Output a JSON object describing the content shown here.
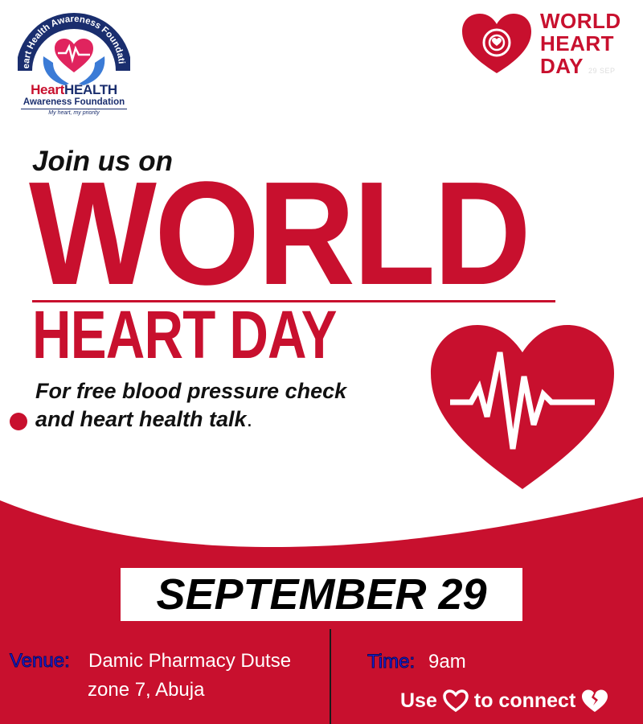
{
  "logo": {
    "arc_text": "Heart Health Awareness Foundation",
    "word_heart": "Heart",
    "word_health": "HEALTH",
    "subtitle": "Awareness Foundation",
    "tagline": "My heart, my priority"
  },
  "whd_logo": {
    "line1": "WORLD",
    "line2": "HEART",
    "line3": "DAY",
    "date": "29 SEP"
  },
  "headline": {
    "intro": "Join us on",
    "world": "WORLD",
    "heart_day": "HEART DAY"
  },
  "description": {
    "line1": "For free blood pressure check",
    "line2": "and heart health talk",
    "period": "."
  },
  "event": {
    "date": "SEPTEMBER 29",
    "venue_label": "Venue:",
    "venue_line1": "Damic Pharmacy Dutse",
    "venue_line2": "zone 7, Abuja",
    "time_label": "Time:",
    "time_value": "9am",
    "connect_prefix": "Use",
    "connect_suffix": "to connect"
  },
  "colors": {
    "brand_red": "#c8102e",
    "navy": "#1a2e6e",
    "label_blue": "#1e1ee6"
  },
  "icons": {
    "logo": "hands-heart-icon",
    "whd": "heart-icon",
    "big": "heartbeat-heart-icon",
    "connect": "heart-outline-icon",
    "broken": "broken-heart-icon"
  }
}
